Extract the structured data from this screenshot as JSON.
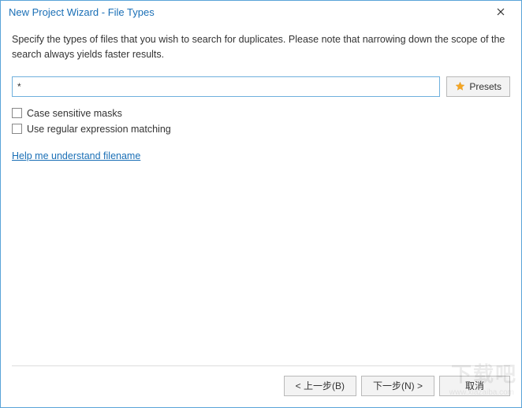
{
  "window": {
    "title": "New Project Wizard - File Types"
  },
  "main": {
    "description": "Specify the types of files that you wish to search for duplicates. Please note that narrowing down the scope of the search always yields faster results.",
    "mask_value": "*",
    "presets_label": "Presets",
    "checkbox_case_label": "Case sensitive masks",
    "checkbox_regex_label": "Use regular expression matching",
    "help_link": "Help me understand filename "
  },
  "footer": {
    "back_label": "< 上一步(B)",
    "next_label": "下一步(N) >",
    "cancel_label": "取消"
  },
  "icons": {
    "close": "close-icon",
    "star": "star-icon"
  }
}
